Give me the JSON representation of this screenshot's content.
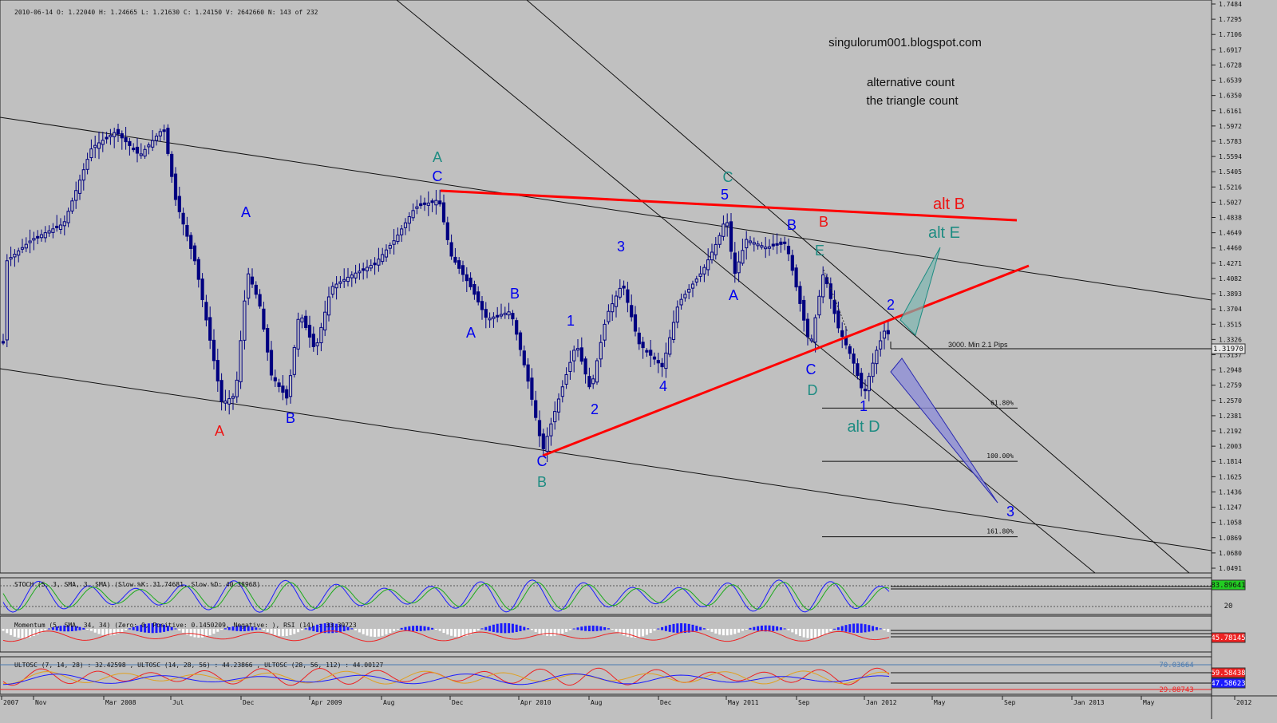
{
  "header": {
    "ohlc": "2010-06-14   O: 1.22040    H: 1.24665    L: 1.21630    C: 1.24150    V: 2642660    N: 143 of 232"
  },
  "annotations": {
    "blog": "singulorum001.blogspot.com",
    "title_line1": "alternative count",
    "title_line2": "the triangle count",
    "pips": "3000. Min 2.1 Pips"
  },
  "colors": {
    "background": "#c0c0c0",
    "candle": "#000080",
    "red_line": "#ff0000",
    "blue_label": "#0000ee",
    "teal_label": "#1e8c82",
    "red_label": "#ee1111"
  },
  "chart_data": {
    "type": "candlestick",
    "instrument": "EUR/USD",
    "y_ticks": [
      "1.7484",
      "1.7295",
      "1.7106",
      "1.6917",
      "1.6728",
      "1.6539",
      "1.6350",
      "1.6161",
      "1.5972",
      "1.5783",
      "1.5594",
      "1.5405",
      "1.5216",
      "1.5027",
      "1.4838",
      "1.4649",
      "1.4460",
      "1.4271",
      "1.4082",
      "1.3893",
      "1.3704",
      "1.3515",
      "1.3326",
      "1.3137",
      "1.2948",
      "1.2759",
      "1.2570",
      "1.2381",
      "1.2192",
      "1.2003",
      "1.1814",
      "1.1625",
      "1.1436",
      "1.1247",
      "1.1058",
      "1.0869",
      "1.0680",
      "1.0491"
    ],
    "ylim": [
      1.0491,
      1.7484
    ],
    "last_price": "1.31970",
    "x_ticks": [
      "2007",
      "Nov",
      "Mar 2008",
      "Jul",
      "Dec",
      "Apr 2009",
      "Aug",
      "Dec",
      "Apr 2010",
      "Aug",
      "Dec",
      "May 2011",
      "Sep",
      "Jan 2012",
      "May",
      "Sep",
      "Jan 2013",
      "May",
      "2012"
    ],
    "fib_levels": [
      {
        "label": "61.80%",
        "value": 1.2475
      },
      {
        "label": "100.00%",
        "value": 1.1815
      },
      {
        "label": "161.80%",
        "value": 1.088
      }
    ],
    "wave_labels": [
      {
        "text": "A",
        "color": "red",
        "x": 275,
        "y": 546
      },
      {
        "text": "A",
        "color": "blue",
        "x": 308,
        "y": 272
      },
      {
        "text": "B",
        "color": "blue",
        "x": 364,
        "y": 530
      },
      {
        "text": "A",
        "color": "teal",
        "x": 548,
        "y": 203
      },
      {
        "text": "C",
        "color": "blue",
        "x": 548,
        "y": 227
      },
      {
        "text": "A",
        "color": "blue",
        "x": 590,
        "y": 423
      },
      {
        "text": "B",
        "color": "blue",
        "x": 645,
        "y": 374
      },
      {
        "text": "C",
        "color": "blue",
        "x": 679,
        "y": 584
      },
      {
        "text": "B",
        "color": "teal",
        "x": 679,
        "y": 610
      },
      {
        "text": "1",
        "color": "blue",
        "x": 715,
        "y": 408
      },
      {
        "text": "2",
        "color": "blue",
        "x": 745,
        "y": 519
      },
      {
        "text": "3",
        "color": "blue",
        "x": 778,
        "y": 315
      },
      {
        "text": "4",
        "color": "blue",
        "x": 831,
        "y": 490
      },
      {
        "text": "C",
        "color": "teal",
        "x": 912,
        "y": 228
      },
      {
        "text": "5",
        "color": "blue",
        "x": 908,
        "y": 250
      },
      {
        "text": "A",
        "color": "blue",
        "x": 919,
        "y": 376
      },
      {
        "text": "B",
        "color": "blue",
        "x": 992,
        "y": 288
      },
      {
        "text": "B",
        "color": "red",
        "x": 1032,
        "y": 284
      },
      {
        "text": "E",
        "color": "teal",
        "x": 1027,
        "y": 320
      },
      {
        "text": "C",
        "color": "blue",
        "x": 1016,
        "y": 469
      },
      {
        "text": "D",
        "color": "teal",
        "x": 1018,
        "y": 495
      },
      {
        "text": "2",
        "color": "blue",
        "x": 1116,
        "y": 388
      },
      {
        "text": "1",
        "color": "blue",
        "x": 1082,
        "y": 515
      },
      {
        "text": "alt D",
        "color": "teal",
        "x": 1082,
        "y": 541
      },
      {
        "text": "alt B",
        "color": "red",
        "x": 1189,
        "y": 262
      },
      {
        "text": "alt E",
        "color": "teal",
        "x": 1183,
        "y": 298
      },
      {
        "text": "3",
        "color": "blue",
        "x": 1266,
        "y": 647
      }
    ]
  },
  "panels": {
    "stoch": {
      "label": "STOCH (5, 3, SMA, 3, SMA) (Slow %K: 31.74681, Slow %D: 40.38968)",
      "value": "83.89641",
      "ref": "20"
    },
    "rsi": {
      "label": "Momentum (5, SMA, 34, 34) (Zero: 0, Positive: 0.1450209, Negative: ), RSI (14) : 33.39723",
      "value": "45.78145"
    },
    "ulto": {
      "label": "ULTOSC (7, 14, 28) : 32.42598 , ULTOSC (14, 28, 56) : 44.23866 , ULTOSC (28, 56, 112) : 44.00127",
      "v70": "70.03664",
      "v1": "59.58438",
      "v2": "47.58623",
      "v30": "29.88743"
    }
  }
}
